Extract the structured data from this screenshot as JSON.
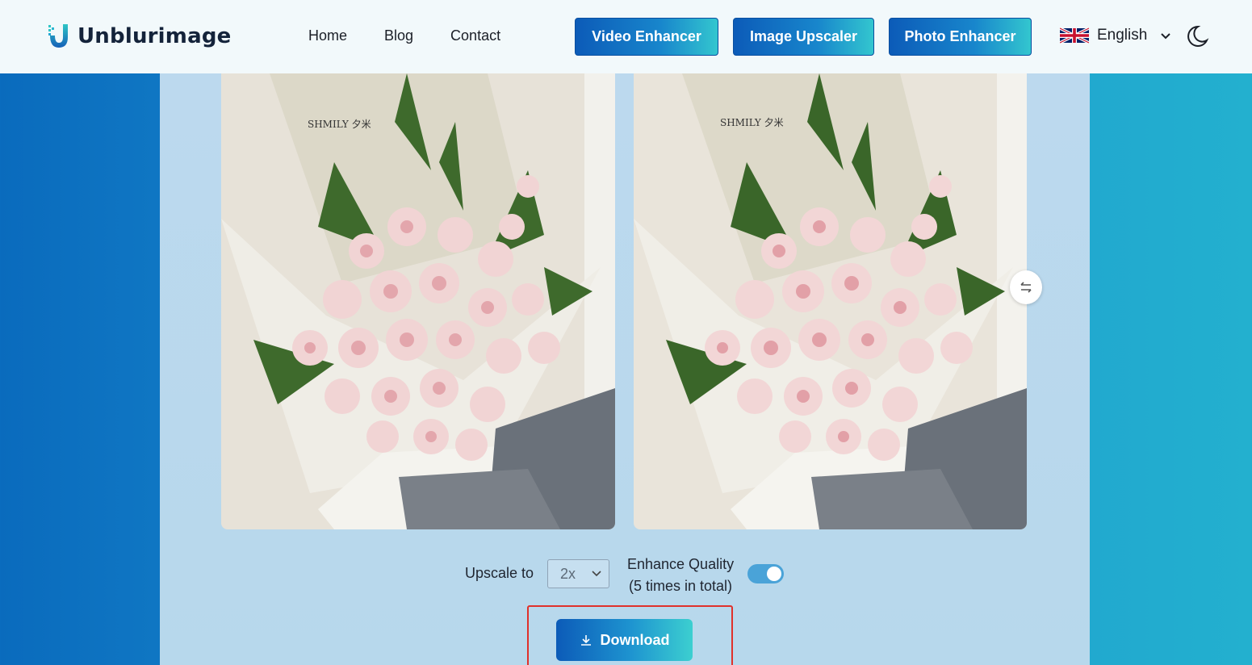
{
  "brand": {
    "name": "Unblurimage"
  },
  "nav": {
    "links": [
      "Home",
      "Blog",
      "Contact"
    ],
    "video_enhancer": "Video Enhancer",
    "image_upscaler": "Image Upscaler",
    "photo_enhancer": "Photo Enhancer"
  },
  "language": {
    "selected": "English",
    "flag_icon": "uk-flag-icon"
  },
  "theme": {
    "icon": "moon-icon"
  },
  "images": {
    "original_caption": "SHMILY 夕米",
    "enhanced_caption": "SHMILY 夕米"
  },
  "controls": {
    "upscale_label": "Upscale to",
    "upscale_value": "2x",
    "quality_label_line1": "Enhance Quality",
    "quality_label_line2": "(5 times in total)",
    "quality_enabled": true
  },
  "download": {
    "label": "Download",
    "icon": "download-icon"
  },
  "colors": {
    "accent_start": "#0c5bb8",
    "accent_end": "#3ccfd0",
    "highlight": "#e0312b"
  }
}
